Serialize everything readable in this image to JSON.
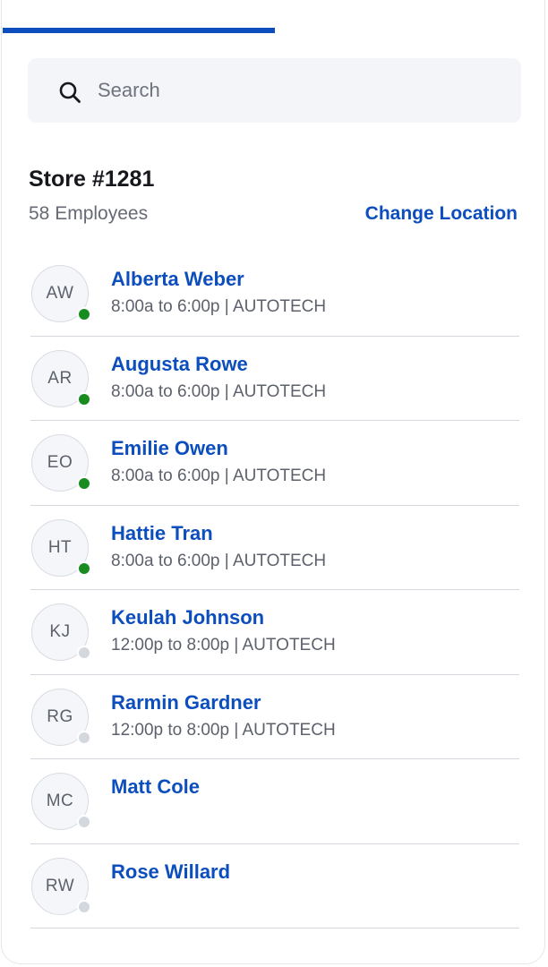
{
  "search": {
    "placeholder": "Search",
    "value": ""
  },
  "store": {
    "title": "Store #1281",
    "employee_count": "58 Employees",
    "change_location_label": "Change Location"
  },
  "colors": {
    "accent": "#0c4ebd",
    "online": "#198c20",
    "offline": "#d3d7de"
  },
  "employees": [
    {
      "initials": "AW",
      "name": "Alberta Weber",
      "shift": "8:00a to 6:00p | AUTOTECH",
      "status": "online"
    },
    {
      "initials": "AR",
      "name": "Augusta Rowe",
      "shift": "8:00a to 6:00p | AUTOTECH",
      "status": "online"
    },
    {
      "initials": "EO",
      "name": "Emilie Owen",
      "shift": "8:00a to 6:00p | AUTOTECH",
      "status": "online"
    },
    {
      "initials": "HT",
      "name": "Hattie Tran",
      "shift": "8:00a to 6:00p | AUTOTECH",
      "status": "online"
    },
    {
      "initials": "KJ",
      "name": "Keulah Johnson",
      "shift": "12:00p to 8:00p | AUTOTECH",
      "status": "offline"
    },
    {
      "initials": "RG",
      "name": "Rarmin Gardner",
      "shift": "12:00p to 8:00p | AUTOTECH",
      "status": "offline"
    },
    {
      "initials": "MC",
      "name": "Matt Cole",
      "shift": "",
      "status": "offline"
    },
    {
      "initials": "RW",
      "name": "Rose Willard",
      "shift": "",
      "status": "offline"
    }
  ]
}
